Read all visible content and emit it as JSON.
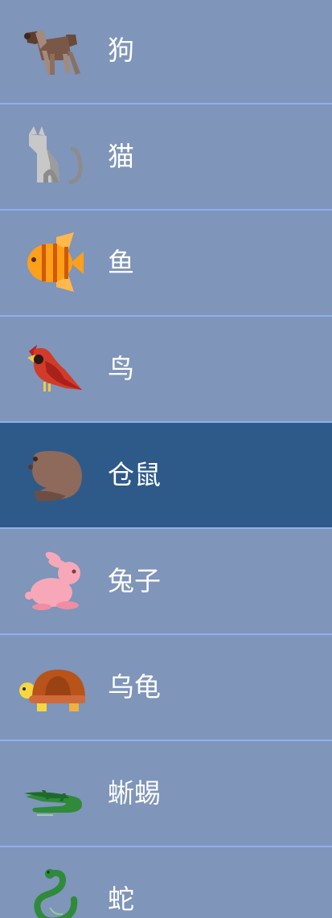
{
  "animal_list": {
    "items": [
      {
        "label": "狗",
        "icon": "dog-icon"
      },
      {
        "label": "猫",
        "icon": "cat-icon"
      },
      {
        "label": "鱼",
        "icon": "fish-icon"
      },
      {
        "label": "鸟",
        "icon": "bird-icon"
      },
      {
        "label": "仓鼠",
        "icon": "hamster-icon",
        "selected": true
      },
      {
        "label": "兔子",
        "icon": "rabbit-icon"
      },
      {
        "label": "乌龟",
        "icon": "turtle-icon"
      },
      {
        "label": "蜥蜴",
        "icon": "lizard-icon"
      },
      {
        "label": "蛇",
        "icon": "snake-icon"
      }
    ]
  },
  "colors": {
    "row_background": "#7f95ba",
    "selected_background": "#2e5a8a",
    "divider": "#8fb0f0",
    "label_text": "#ffffff"
  }
}
